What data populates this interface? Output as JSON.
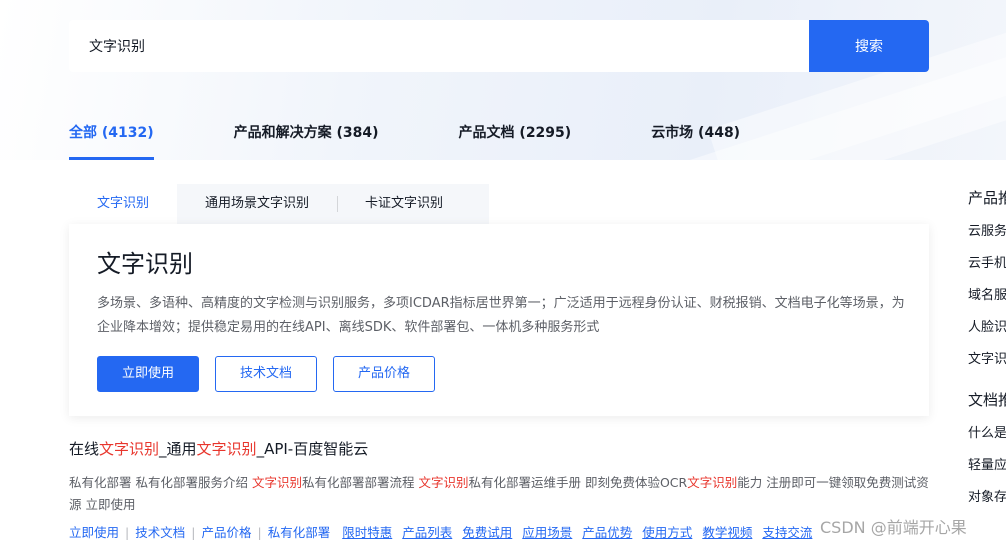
{
  "search": {
    "value": "文字识别",
    "button_label": "搜索"
  },
  "top_tabs": [
    {
      "label": "全部 (4132)",
      "active": true
    },
    {
      "label": "产品和解决方案 (384)"
    },
    {
      "label": "产品文档 (2295)"
    },
    {
      "label": "云市场 (448)"
    }
  ],
  "product_card": {
    "tabs": [
      "文字识别",
      "通用场景文字识别",
      "卡证文字识别"
    ],
    "title": "文字识别",
    "description": "多场景、多语种、高精度的文字检测与识别服务，多项ICDAR指标居世界第一；广泛适用于远程身份认证、财税报销、文档电子化等场景，为企业降本增效；提供稳定易用的在线API、离线SDK、软件部署包、一体机多种服务形式",
    "buttons": {
      "primary": "立即使用",
      "docs": "技术文档",
      "price": "产品价格"
    }
  },
  "result": {
    "title_parts": [
      "在线",
      "文字识别",
      "_通用",
      "文字识别",
      "_API-百度智能云"
    ],
    "desc_parts": [
      "私有化部署 私有化部署服务介绍 ",
      "文字识别",
      "私有化部署部署流程 ",
      "文字识别",
      "私有化部署运维手册 即刻免费体验OCR",
      "文字识别",
      "能力 注册即可一键领取免费测试资源 立即使用"
    ],
    "links_primary": [
      "立即使用",
      "技术文档",
      "产品价格",
      "私有化部署"
    ],
    "links_secondary": [
      "限时特惠",
      "产品列表",
      "免费试用",
      "应用场景",
      "产品优势",
      "使用方式",
      "教学视频",
      "支持交流"
    ]
  },
  "sidebar": {
    "heading1": "产品推荐",
    "items": [
      "云服务器",
      "云手机",
      "域名服务",
      "人脸识别",
      "文字识别"
    ],
    "heading2": "文档推荐",
    "doc_items": [
      "什么是",
      "轻量应用",
      "对象存储"
    ]
  },
  "watermark": "CSDN @前端开心果",
  "colors": {
    "accent": "#2468f2",
    "highlight": "#e8352c"
  }
}
